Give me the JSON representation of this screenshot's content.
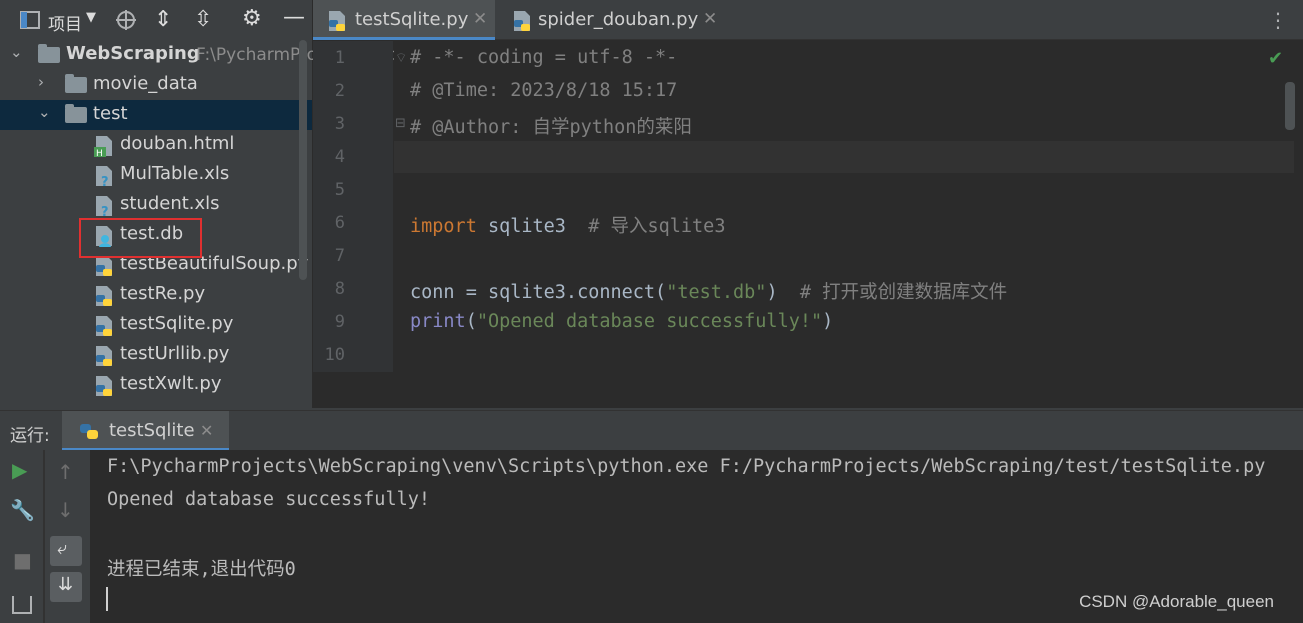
{
  "project_panel": {
    "title": "项目",
    "tree": [
      {
        "label": "WebScraping",
        "hint": "F:\\PycharmProjects\\WebScraping",
        "kind": "folder",
        "expanded": true
      },
      {
        "label": "movie_data",
        "kind": "folder",
        "expanded": false
      },
      {
        "label": "test",
        "kind": "folder",
        "expanded": true,
        "selected": true
      },
      {
        "label": "douban.html",
        "kind": "html"
      },
      {
        "label": "MulTable.xls",
        "kind": "unknown"
      },
      {
        "label": "student.xls",
        "kind": "unknown"
      },
      {
        "label": "test.db",
        "kind": "db",
        "highlighted": true
      },
      {
        "label": "testBeautifulSoup.py",
        "kind": "python"
      },
      {
        "label": "testRe.py",
        "kind": "python"
      },
      {
        "label": "testSqlite.py",
        "kind": "python"
      },
      {
        "label": "testUrllib.py",
        "kind": "python"
      },
      {
        "label": "testXwlt.py",
        "kind": "python"
      }
    ]
  },
  "editor": {
    "tabs": [
      {
        "label": "testSqlite.py",
        "active": true
      },
      {
        "label": "spider_douban.py",
        "active": false
      }
    ],
    "line_numbers": [
      "1",
      "2",
      "3",
      "4",
      "5",
      "6",
      "7",
      "8",
      "9",
      "10"
    ],
    "code": {
      "l1": "# -*- coding = utf-8 -*-",
      "l2": "# @Time: 2023/8/18 15:17",
      "l3_a": "# @Author: ",
      "l3_b": "自学python的莱阳",
      "l6_kw": "import",
      "l6_mod": " sqlite3  ",
      "l6_cmt": "# 导入sqlite3",
      "l8_a": "conn = sqlite3.connect(",
      "l8_str": "\"test.db\"",
      "l8_b": ")  ",
      "l8_cmt": "# 打开或创建数据库文件",
      "l9_fn": "print",
      "l9_a": "(",
      "l9_str": "\"Opened database successfully!\"",
      "l9_b": ")"
    }
  },
  "run_panel": {
    "label": "运行:",
    "tab": "testSqlite",
    "output": [
      "F:\\PycharmProjects\\WebScraping\\venv\\Scripts\\python.exe F:/PycharmProjects/WebScraping/test/testSqlite.py",
      "Opened database successfully!",
      "",
      "进程已结束,退出代码0"
    ]
  },
  "watermark": "CSDN @Adorable_queen",
  "colors": {
    "accent": "#4a88c7",
    "highlight_box": "#e03030",
    "keyword": "#cc7832",
    "string": "#6a8759"
  }
}
